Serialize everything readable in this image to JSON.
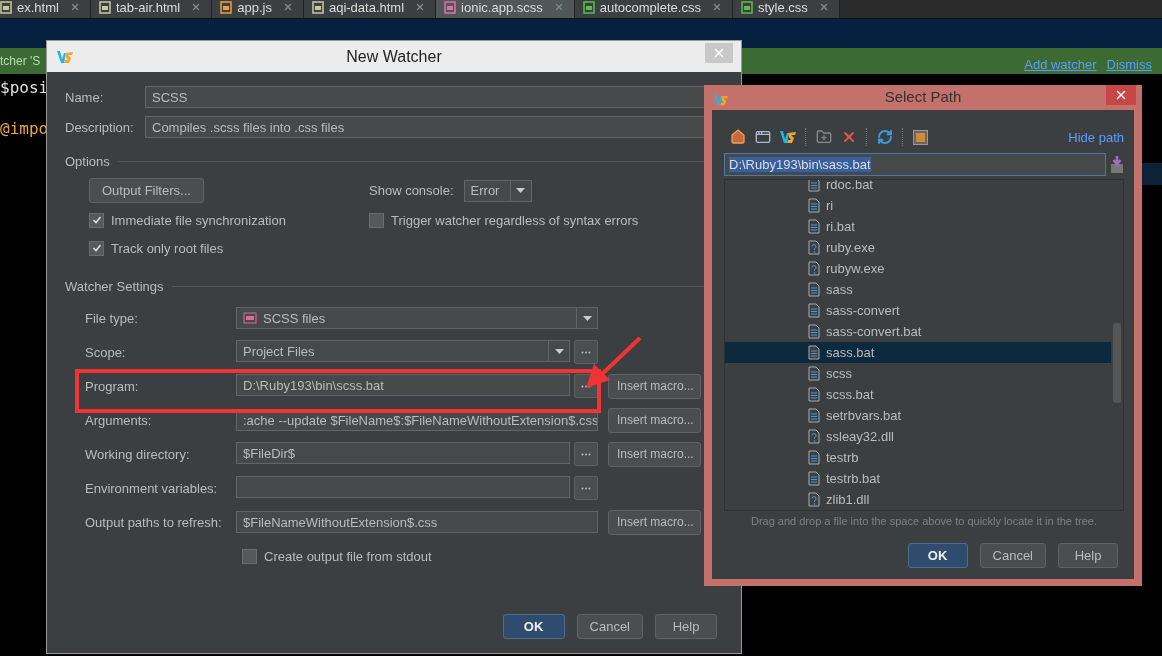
{
  "editor_tabs": [
    {
      "label": "ex.html",
      "kind": "html",
      "selected": false
    },
    {
      "label": "tab-air.html",
      "kind": "html",
      "selected": false
    },
    {
      "label": "app.js",
      "kind": "js",
      "selected": false
    },
    {
      "label": "aqi-data.html",
      "kind": "html",
      "selected": false
    },
    {
      "label": "ionic.app.scss",
      "kind": "sass",
      "selected": true
    },
    {
      "label": "autocomplete.css",
      "kind": "css",
      "selected": false
    },
    {
      "label": "style.css",
      "kind": "css",
      "selected": false
    }
  ],
  "notification": {
    "text": "tcher 'S",
    "links": [
      "Add watcher",
      "Dismiss"
    ]
  },
  "code_lines": [
    {
      "text": "$posi",
      "kind": "variable"
    },
    {
      "text": "@impo",
      "kind": "directive"
    }
  ],
  "new_watcher": {
    "title": "New Watcher",
    "fields": [
      {
        "label": "Name:",
        "value": "SCSS"
      },
      {
        "label": "Description:",
        "value": "Compiles .scss files into .css files"
      }
    ],
    "options": {
      "heading": "Options",
      "output_filters_button": "Output Filters...",
      "show_console": {
        "label": "Show console:",
        "value": "Error"
      },
      "checkboxes": [
        {
          "label": "Immediate file synchronization",
          "checked": true
        },
        {
          "label": "Trigger watcher regardless of syntax errors",
          "checked": false
        },
        {
          "label": "Track only root files",
          "checked": true
        }
      ]
    },
    "watcher_settings": {
      "heading": "Watcher Settings",
      "rows": [
        {
          "kind": "combo",
          "label": "File type:",
          "value": "SCSS files"
        },
        {
          "kind": "combo_dots",
          "label": "Scope:",
          "value": "Project Files"
        },
        {
          "kind": "field_dots",
          "label": "Program:",
          "value": "D:\\Ruby193\\bin\\scss.bat",
          "macro_button": "Insert macro..."
        },
        {
          "kind": "field",
          "label": "Arguments:",
          "value": ":ache --update $FileName$:$FileNameWithoutExtension$.css",
          "macro_button": "Insert macro..."
        },
        {
          "kind": "field_dots",
          "label": "Working directory:",
          "value": "$FileDir$",
          "macro_button": "Insert macro..."
        },
        {
          "kind": "field_dots",
          "label": "Environment variables:",
          "value": ""
        },
        {
          "kind": "field",
          "label": "Output paths to refresh:",
          "value": "$FileNameWithoutExtension$.css",
          "macro_button": "Insert macro..."
        }
      ]
    },
    "create_output": {
      "label": "Create output file from stdout",
      "checked": false
    },
    "buttons": [
      {
        "label": "OK",
        "primary": true
      },
      {
        "label": "Cancel",
        "primary": false
      },
      {
        "label": "Help",
        "primary": false
      }
    ]
  },
  "select_path": {
    "title": "Select Path",
    "hide_path_link": "Hide path",
    "path": "D:\\Ruby193\\bin\\sass.bat",
    "files": [
      {
        "name": "rdoc.bat",
        "kind": "script",
        "selected": false
      },
      {
        "name": "ri",
        "kind": "script",
        "selected": false
      },
      {
        "name": "ri.bat",
        "kind": "script",
        "selected": false
      },
      {
        "name": "ruby.exe",
        "kind": "unknown",
        "selected": false
      },
      {
        "name": "rubyw.exe",
        "kind": "unknown",
        "selected": false
      },
      {
        "name": "sass",
        "kind": "script",
        "selected": false
      },
      {
        "name": "sass-convert",
        "kind": "script",
        "selected": false
      },
      {
        "name": "sass-convert.bat",
        "kind": "script",
        "selected": false
      },
      {
        "name": "sass.bat",
        "kind": "script",
        "selected": true
      },
      {
        "name": "scss",
        "kind": "script",
        "selected": false
      },
      {
        "name": "scss.bat",
        "kind": "script",
        "selected": false
      },
      {
        "name": "setrbvars.bat",
        "kind": "script",
        "selected": false
      },
      {
        "name": "ssleay32.dll",
        "kind": "unknown",
        "selected": false
      },
      {
        "name": "testrb",
        "kind": "script",
        "selected": false
      },
      {
        "name": "testrb.bat",
        "kind": "script",
        "selected": false
      },
      {
        "name": "zlib1.dll",
        "kind": "unknown",
        "selected": false
      }
    ],
    "hint": "Drag and drop a file into the space above to quickly locate it in the tree.",
    "buttons": [
      {
        "label": "OK",
        "primary": true
      },
      {
        "label": "Cancel",
        "primary": false
      },
      {
        "label": "Help",
        "primary": false
      }
    ]
  }
}
